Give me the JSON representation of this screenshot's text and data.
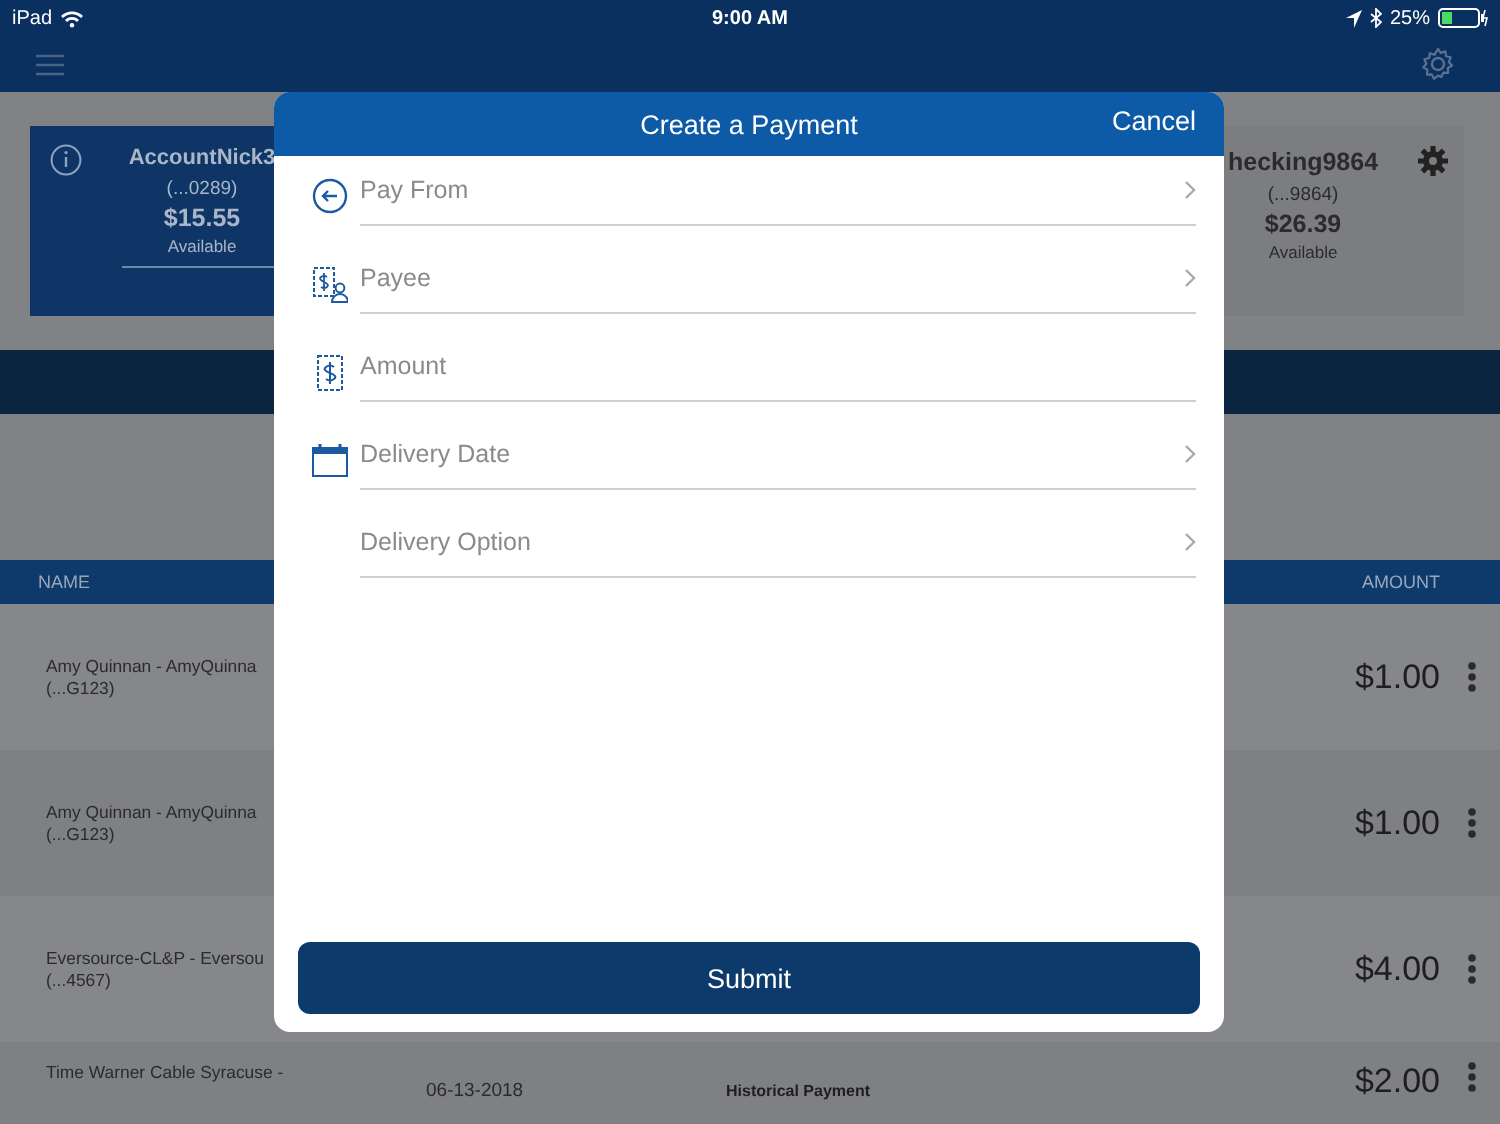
{
  "status_bar": {
    "device": "iPad",
    "time": "9:00 AM",
    "battery": "25%"
  },
  "accounts": [
    {
      "name": "AccountNick3",
      "number": "(...0289)",
      "balance": "$15.55",
      "label": "Available",
      "selected": true
    },
    {
      "name": "hecking9864",
      "number": "(...9864)",
      "balance": "$26.39",
      "label": "Available",
      "selected": false
    }
  ],
  "table": {
    "columns": [
      "NAME",
      "AMOUNT"
    ],
    "rows": [
      {
        "name": "Amy Quinnan - AmyQuinna",
        "account": "(...G123)",
        "amount": "$1.00"
      },
      {
        "name": "Amy Quinnan - AmyQuinna",
        "account": "(...G123)",
        "amount": "$1.00"
      },
      {
        "name": "Eversource-CL&P - Eversou",
        "account": "(...4567)",
        "amount": "$4.00"
      },
      {
        "name": "Time Warner Cable Syracuse -",
        "date": "06-13-2018",
        "type": "Historical Payment",
        "amount": "$2.00"
      }
    ]
  },
  "dialog": {
    "title": "Create a Payment",
    "cancel": "Cancel",
    "fields": [
      {
        "kind": "account",
        "label": "Pay From",
        "chevron": true
      },
      {
        "kind": "payee",
        "label": "Payee",
        "chevron": true
      },
      {
        "kind": "amount",
        "label": "Amount",
        "chevron": false
      },
      {
        "kind": "date",
        "label": "Delivery Date",
        "chevron": true
      },
      {
        "kind": "option",
        "label": "Delivery Option",
        "chevron": true
      }
    ],
    "submit": "Submit"
  }
}
